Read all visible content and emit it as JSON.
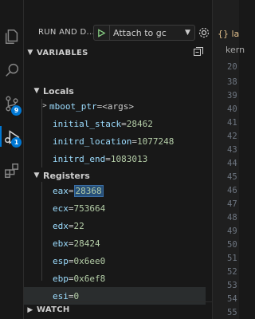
{
  "debug_header": {
    "title": "RUN AND D...",
    "launch_config": "Attach to gc"
  },
  "sections": {
    "variables": "VARIABLES",
    "watch": "WATCH"
  },
  "locals": {
    "label": "Locals",
    "items": [
      {
        "name": "mboot_ptr",
        "eq": " = ",
        "value": "<args>"
      },
      {
        "name": "initial_stack",
        "eq": " = ",
        "value": "28462"
      },
      {
        "name": "initrd_location",
        "eq": " = ",
        "value": "1077248"
      },
      {
        "name": "initrd_end",
        "eq": " = ",
        "value": "1083013"
      }
    ]
  },
  "registers": {
    "label": "Registers",
    "items": [
      {
        "name": "eax",
        "eq": " = ",
        "value": "28368"
      },
      {
        "name": "ecx",
        "eq": " = ",
        "value": "753664"
      },
      {
        "name": "edx",
        "eq": " = ",
        "value": "22"
      },
      {
        "name": "ebx",
        "eq": " = ",
        "value": "28424"
      },
      {
        "name": "esp",
        "eq": " = ",
        "value": "0x6ee0"
      },
      {
        "name": "ebp",
        "eq": " = ",
        "value": "0x6ef8"
      },
      {
        "name": "esi",
        "eq": " = ",
        "value": "0"
      }
    ]
  },
  "activity_badges": {
    "source_control": "9",
    "run_debug": "1"
  },
  "editor": {
    "tab_label": "{} la",
    "breadcrumb": "kern",
    "line_numbers": [
      "20",
      "38",
      "39",
      "40",
      "41",
      "42",
      "43",
      "44",
      "45",
      "46",
      "47",
      "48",
      "49",
      "50",
      "51",
      "52",
      "53",
      "54",
      "55",
      "56",
      "57",
      "58"
    ]
  },
  "colors": {
    "accent": "#0078d4",
    "var_name": "#9cdcfe",
    "var_value": "#b5cea8",
    "background": "#181818"
  }
}
